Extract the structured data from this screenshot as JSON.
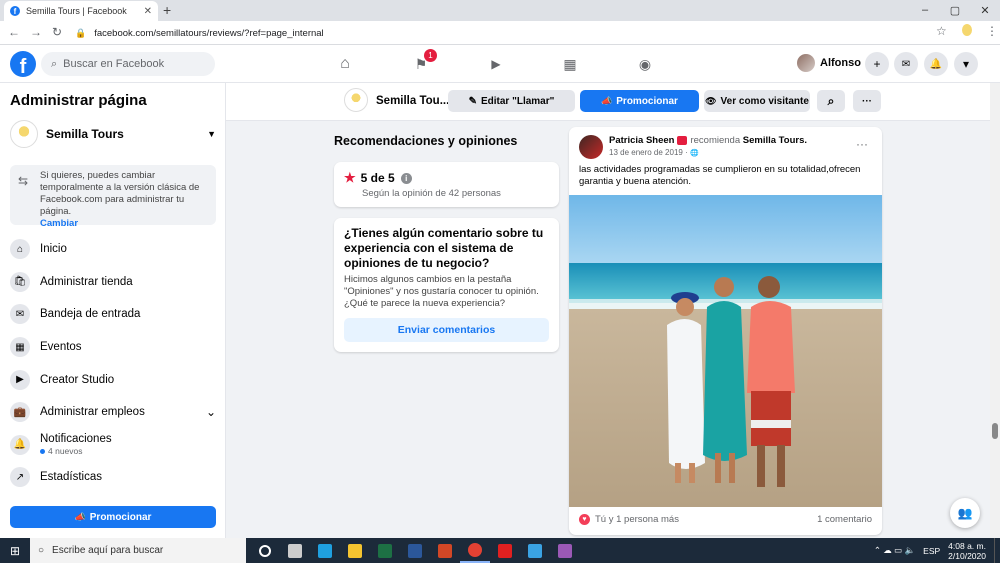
{
  "browser": {
    "tab_title": "Semilla Tours | Facebook",
    "tab_favicon": "f",
    "url": "facebook.com/semillatours/reviews/?ref=page_internal",
    "nav_icons": {
      "back": "←",
      "forward": "→",
      "reload": "↻",
      "star": "☆",
      "menu": "⋮",
      "lock": "🔒"
    },
    "win": {
      "min": "–",
      "max": "▢",
      "close": "✕"
    },
    "close_tab": "✕",
    "new_tab": "+"
  },
  "fb": {
    "logo": "f",
    "search_placeholder": "Buscar en Facebook",
    "search_icon": "⌕",
    "nav": {
      "home": "⌂",
      "pages": "⚑",
      "watch": "▶",
      "marketplace": "▦",
      "groups": "◉"
    },
    "pages_badge": "1",
    "user_name": "Alfonso",
    "actions": {
      "create": "+",
      "messenger": "✉",
      "notifications": "🔔",
      "account": "▾"
    }
  },
  "sidebar": {
    "title": "Administrar página",
    "page_name": "Semilla Tours",
    "dropdown": "▼",
    "info_icon": "⇆",
    "info_text": "Si quieres, puedes cambiar temporalmente a la versión clásica de Facebook.com para administrar tu página.",
    "info_link": "Cambiar",
    "items": [
      {
        "icon": "⌂",
        "label": "Inicio"
      },
      {
        "icon": "🛍",
        "label": "Administrar tienda"
      },
      {
        "icon": "✉",
        "label": "Bandeja de entrada"
      },
      {
        "icon": "▦",
        "label": "Eventos"
      },
      {
        "icon": "▶",
        "label": "Creator Studio"
      },
      {
        "icon": "💼",
        "label": "Administrar empleos",
        "chevron": "⌄"
      },
      {
        "icon": "🔔",
        "label": "Notificaciones",
        "sub": "4 nuevos"
      },
      {
        "icon": "↗",
        "label": "Estadísticas"
      }
    ],
    "promote": "Promocionar",
    "promote_icon": "📣"
  },
  "pagebar": {
    "page_name": "Semilla Tou...",
    "edit_label": "Editar \"Llamar\"",
    "edit_icon": "✎",
    "promote_label": "Promocionar",
    "promote_icon": "📣",
    "view_label": "Ver como visitante",
    "view_icon": "👁",
    "search_icon": "⌕",
    "more_icon": "···"
  },
  "reviews": {
    "heading": "Recomendaciones y opiniones",
    "score": "5 de 5",
    "star": "★",
    "info_icon": "i",
    "basis": "Según la opinión de 42 personas",
    "feedback_question": "¿Tienes algún comentario sobre tu experiencia con el sistema de opiniones de tu negocio?",
    "feedback_text": "Hicimos algunos cambios en la pestaña \"Opiniones\" y nos gustaría conocer tu opinión. ¿Qué te parece la nueva experiencia?",
    "feedback_button": "Enviar comentarios"
  },
  "post": {
    "author": "Patricia Sheen",
    "verb": "recomienda",
    "target": "Semilla Tours.",
    "date": "13 de enero de 2019 · ",
    "privacy_icon": "🌐",
    "more_icon": "···",
    "text": "las actividades programadas se cumplieron en su totalidad,ofrecen garantia y buena atención.",
    "reactions": "Tú y 1 persona más",
    "reaction_icon": "♥",
    "comments": "1 comentario"
  },
  "fab_icon": "👥",
  "taskbar": {
    "start_icon": "⊞",
    "search_icon": "○",
    "search_placeholder": "Escribe aquí para buscar",
    "apps": [
      {
        "name": "cortana",
        "color": "#ffffff"
      },
      {
        "name": "task-view",
        "color": "#cccccc"
      },
      {
        "name": "edge",
        "color": "#1fa0e0"
      },
      {
        "name": "explorer",
        "color": "#f4c430"
      },
      {
        "name": "excel",
        "color": "#1d7044"
      },
      {
        "name": "word",
        "color": "#2b579a"
      },
      {
        "name": "powerpoint",
        "color": "#d24726"
      },
      {
        "name": "chrome",
        "color": "#e34133"
      },
      {
        "name": "acrobat",
        "color": "#e02020"
      },
      {
        "name": "app-blue",
        "color": "#3aa3e3"
      },
      {
        "name": "app-drop",
        "color": "#9b59b6"
      }
    ],
    "tray_icons": "⌃  ☁  ▭  🔈",
    "lang": "ESP",
    "time": "4:08 a. m.",
    "date": "2/10/2020"
  }
}
